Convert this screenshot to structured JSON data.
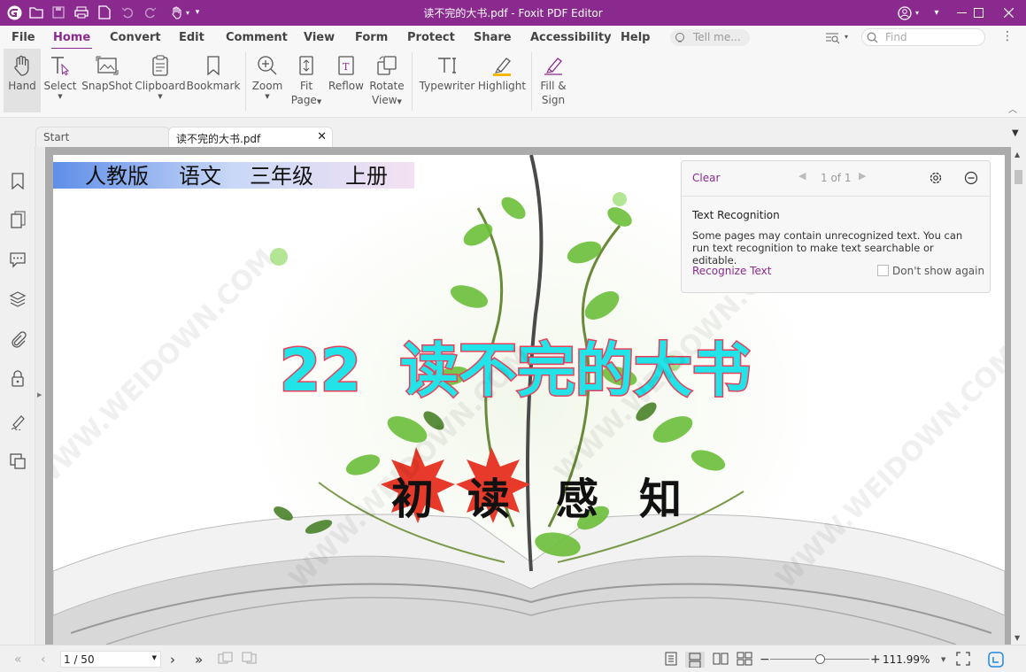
{
  "window": {
    "title": "读不完的大书.pdf - Foxit PDF Editor"
  },
  "menu": [
    "File",
    "Home",
    "Convert",
    "Edit",
    "Comment",
    "View",
    "Form",
    "Protect",
    "Share",
    "Accessibility",
    "Help"
  ],
  "tell_me": {
    "placeholder": "Tell me..."
  },
  "find": {
    "placeholder": "Find"
  },
  "ribbon": {
    "hand": "Hand",
    "select": "Select",
    "snapshot": "SnapShot",
    "clipboard": "Clipboard",
    "bookmark": "Bookmark",
    "zoom": "Zoom",
    "fit_page_1": "Fit",
    "fit_page_2": "Page",
    "reflow": "Reflow",
    "rotate_1": "Rotate",
    "rotate_2": "View",
    "typewriter": "Typewriter",
    "highlight": "Highlight",
    "fill_1": "Fill &",
    "fill_2": "Sign"
  },
  "tabs": {
    "start": "Start",
    "doc": "读不完的大书.pdf"
  },
  "page": {
    "banner": [
      "人教版",
      "语文",
      "三年级",
      "上册"
    ],
    "lesson_number": "22",
    "lesson_title": "读不完的大书",
    "section": [
      "初",
      "读",
      "感",
      "知"
    ],
    "watermark": "WWW.WEIDOWN.COM"
  },
  "panel": {
    "clear": "Clear",
    "page_count": "1 of 1",
    "heading": "Text Recognition",
    "body": "Some pages may contain unrecognized text. You can run text recognition to make text searchable or editable.",
    "action": "Recognize Text",
    "dont_show": "Don't show again"
  },
  "status": {
    "page": "1 / 50",
    "zoom": "111.99%"
  },
  "colors": {
    "accent": "#8a2a8f",
    "title_cyan": "#22e3e8",
    "title_outline": "#e8405a"
  }
}
